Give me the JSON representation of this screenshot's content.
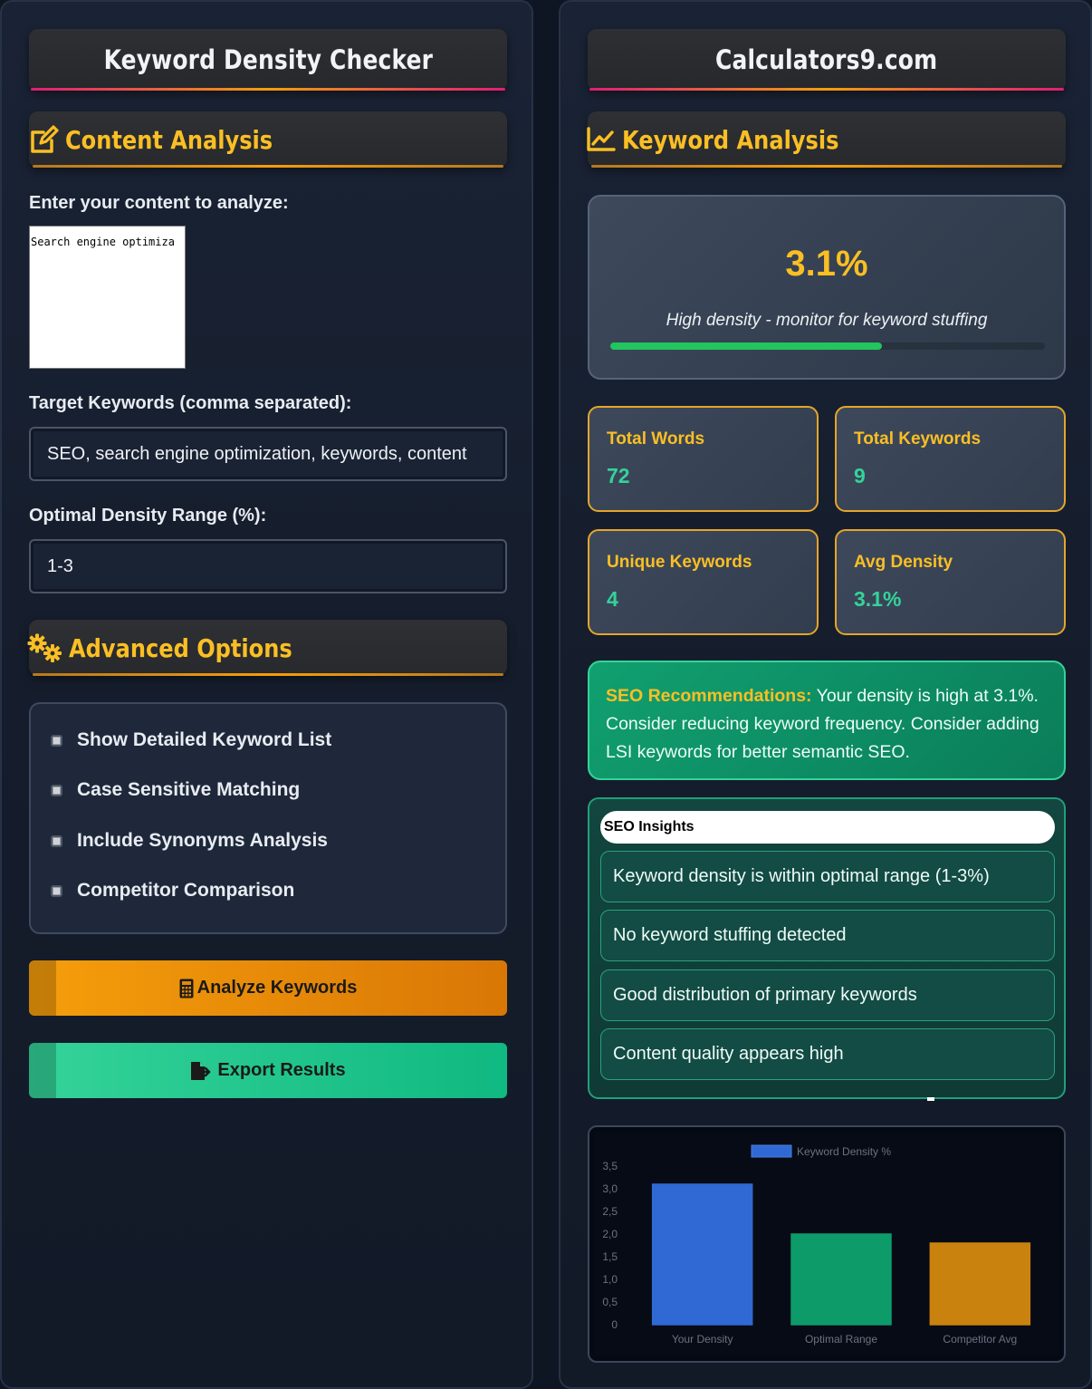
{
  "left": {
    "title": "Keyword Density Checker",
    "content_section": {
      "title": "Content Analysis",
      "icon": "edit-icon"
    },
    "content_label": "Enter your content to analyze:",
    "content_value": "Search engine optimiza",
    "keywords_label": "Target Keywords (comma separated):",
    "keywords_value": "SEO, search engine optimization, keywords, content",
    "density_label": "Optimal Density Range (%):",
    "density_value": "1-3",
    "advanced_section": {
      "title": "Advanced Options",
      "icon": "gears-icon"
    },
    "options": [
      {
        "label": "Show Detailed Keyword List"
      },
      {
        "label": "Case Sensitive Matching"
      },
      {
        "label": "Include Synonyms Analysis"
      },
      {
        "label": "Competitor Comparison"
      }
    ],
    "analyze_button": {
      "label": "Analyze Keywords",
      "icon": "calculator-icon"
    },
    "export_button": {
      "label": "Export Results",
      "icon": "file-export-icon"
    }
  },
  "right": {
    "title": "Calculators9.com",
    "analysis_section": {
      "title": "Keyword Analysis",
      "icon": "chart-line-icon"
    },
    "result": {
      "value": "3.1%",
      "description": "High density - monitor for keyword stuffing",
      "progress_fraction": 0.625
    },
    "stats": [
      {
        "label": "Total Words",
        "value": "72"
      },
      {
        "label": "Total Keywords",
        "value": "9"
      },
      {
        "label": "Unique Keywords",
        "value": "4"
      },
      {
        "label": "Avg Density",
        "value": "3.1%"
      }
    ],
    "recommendation": {
      "label": "SEO Recommendations:",
      "text": " Your density is high at 3.1%. Consider reducing keyword frequency. Consider adding LSI keywords for better semantic SEO."
    },
    "insights": {
      "title": "SEO Insights",
      "items": [
        "Keyword density is within optimal range (1-3%)",
        "No keyword stuffing detected",
        "Good distribution of primary keywords",
        "Content quality appears high"
      ]
    }
  },
  "colors": {
    "accent_yellow": "#fbbf24",
    "accent_green": "#34d399",
    "bar_blue": "#3069d4",
    "bar_green": "#0d9b6a",
    "bar_orange": "#c9820e"
  },
  "chart_data": {
    "type": "bar",
    "categories": [
      "Your Density",
      "Optimal Range",
      "Competitor Avg"
    ],
    "series": [
      {
        "name": "Keyword Density %",
        "values": [
          3.1,
          2.0,
          1.8
        ]
      }
    ],
    "ylim": [
      0,
      3.5
    ],
    "yticks": [
      "0",
      "0,5",
      "1,0",
      "1,5",
      "2,0",
      "2,5",
      "3,0",
      "3,5"
    ],
    "colors": [
      "#3069d4",
      "#0d9b6a",
      "#c9820e"
    ],
    "legend_position": "top",
    "grid": false
  }
}
